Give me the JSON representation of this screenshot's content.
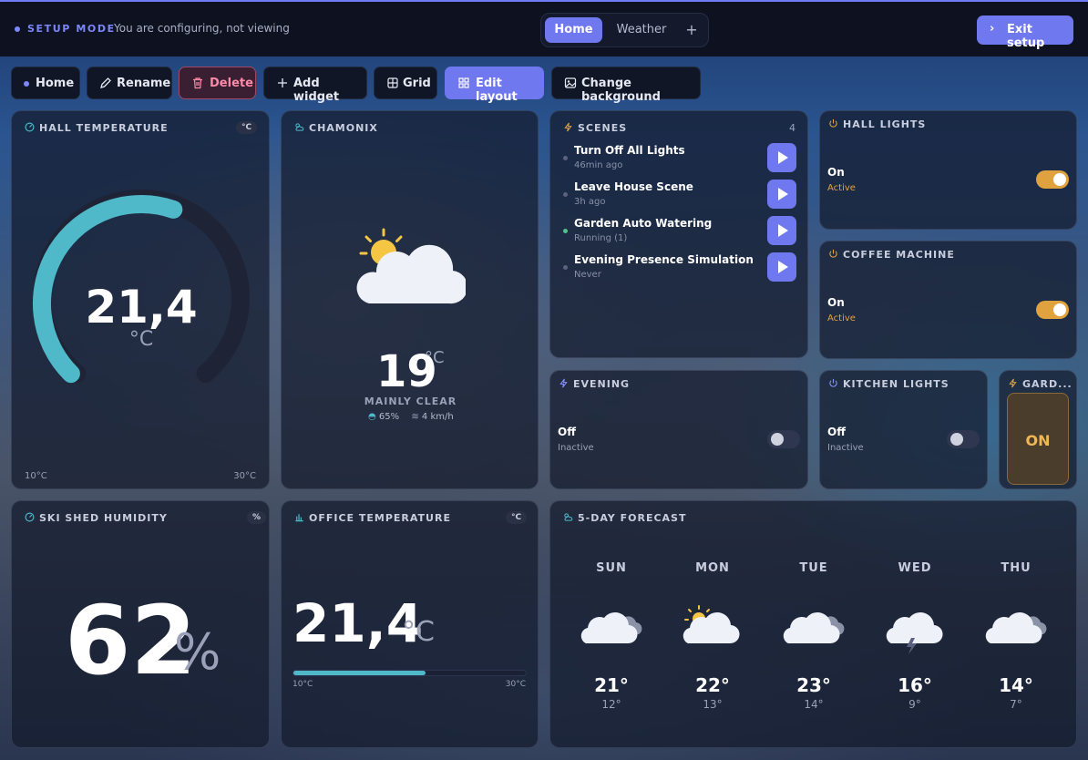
{
  "topbar": {
    "mode_label": "SETUP MODE",
    "mode_description": "You are configuring, not viewing",
    "tabs": [
      {
        "label": "Home",
        "active": true
      },
      {
        "label": "Weather",
        "active": false
      }
    ],
    "add_tab_icon": "plus-icon",
    "exit_label": "Exit setup"
  },
  "toolbar": {
    "home_label": "Home",
    "rename_label": "Rename",
    "delete_label": "Delete",
    "add_widget_label": "Add widget",
    "grid_label": "Grid",
    "edit_layout_label": "Edit layout",
    "change_background_label": "Change background"
  },
  "colors": {
    "accent": "#6f78ef",
    "gauge": "#4fb8c9",
    "warning": "#e0a23e",
    "danger": "#ff8aa8"
  },
  "hall_temperature": {
    "title": "HALL TEMPERATURE",
    "unit_badge": "°C",
    "value": "21,4",
    "unit": "°C",
    "min_label": "10°C",
    "max_label": "30°C",
    "fill_fraction": 0.57
  },
  "chamonix": {
    "title": "CHAMONIX",
    "temp": "19",
    "unit": "°C",
    "condition": "MAINLY CLEAR",
    "humidity": "65%",
    "wind": "4 km/h"
  },
  "scenes": {
    "title": "SCENES",
    "count": "4",
    "items": [
      {
        "name": "Turn Off All Lights",
        "sub": "46min ago",
        "running": false
      },
      {
        "name": "Leave House Scene",
        "sub": "3h ago",
        "running": false
      },
      {
        "name": "Garden Auto Watering",
        "sub": "Running (1)",
        "running": true
      },
      {
        "name": "Evening Presence Simulation",
        "sub": "Never",
        "running": false
      }
    ]
  },
  "hall_lights": {
    "title": "HALL LIGHTS",
    "state": "On",
    "sub": "Active"
  },
  "coffee_machine": {
    "title": "COFFEE MACHINE",
    "state": "On",
    "sub": "Active"
  },
  "evening": {
    "title": "EVENING",
    "state": "Off",
    "sub": "Inactive"
  },
  "kitchen_lights": {
    "title": "KITCHEN LIGHTS",
    "state": "Off",
    "sub": "Inactive"
  },
  "garden": {
    "title": "GARD...",
    "button_label": "ON"
  },
  "ski_shed_humidity": {
    "title": "SKI SHED HUMIDITY",
    "unit_badge": "%",
    "value": "62",
    "unit": "%"
  },
  "office_temperature": {
    "title": "OFFICE TEMPERATURE",
    "unit_badge": "°C",
    "value": "21,4",
    "unit": "°C",
    "min_label": "10°C",
    "max_label": "30°C",
    "fill_fraction": 0.57
  },
  "forecast": {
    "title": "5-DAY FORECAST",
    "days": [
      {
        "day": "SUN",
        "hi": "21°",
        "lo": "12°",
        "icon": "cloudy-icon"
      },
      {
        "day": "MON",
        "hi": "22°",
        "lo": "13°",
        "icon": "partly-sunny-icon"
      },
      {
        "day": "TUE",
        "hi": "23°",
        "lo": "14°",
        "icon": "cloudy-icon"
      },
      {
        "day": "WED",
        "hi": "16°",
        "lo": "9°",
        "icon": "storm-icon"
      },
      {
        "day": "THU",
        "hi": "14°",
        "lo": "7°",
        "icon": "cloudy-icon"
      }
    ]
  }
}
